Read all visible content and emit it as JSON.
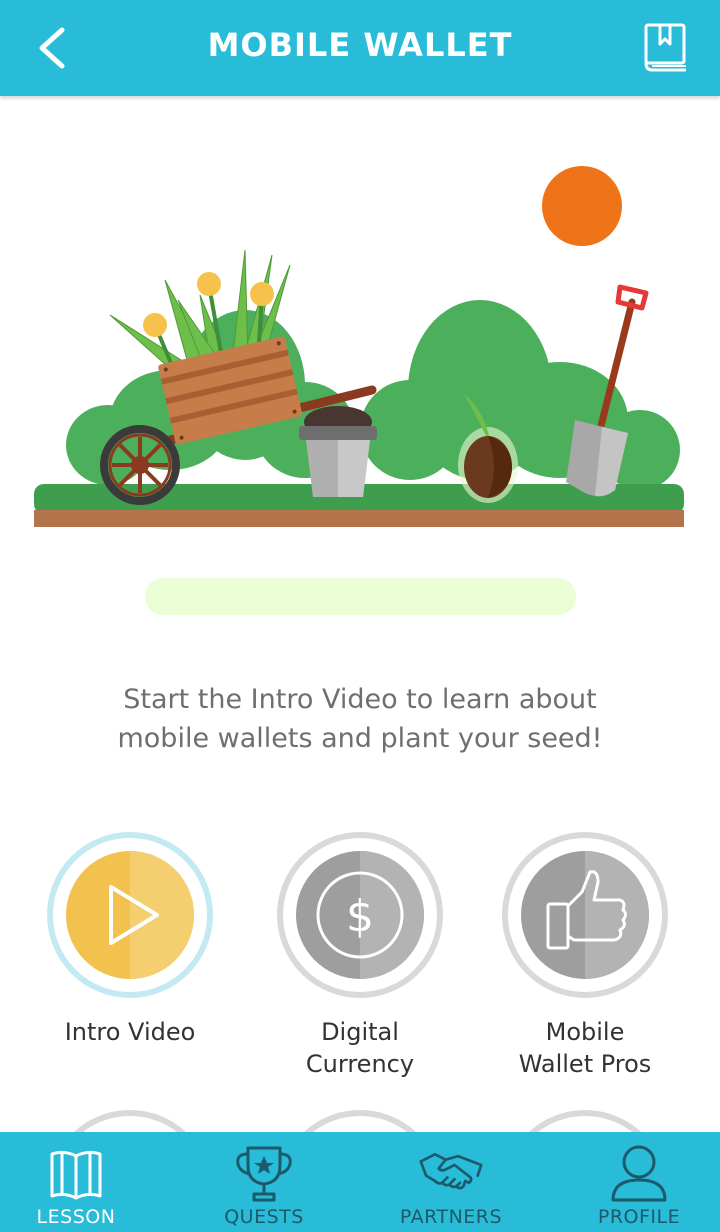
{
  "header": {
    "title": "MOBILE WALLET",
    "back_icon": "chevron-left-icon",
    "book_icon": "book-bookmark-icon",
    "background": "#29BCD9"
  },
  "progress": {
    "fraction": 0
  },
  "intro": {
    "line1": "Start the Intro Video to learn about",
    "line2": "mobile wallets and plant your seed!"
  },
  "lessons": [
    {
      "label": "Intro Video",
      "icon": "play-icon",
      "state": "active"
    },
    {
      "label_line1": "Digital",
      "label_line2": "Currency",
      "icon": "dollar-icon",
      "state": "locked"
    },
    {
      "label_line1": "Mobile",
      "label_line2": "Wallet Pros",
      "icon": "thumbs-up-icon",
      "state": "locked"
    }
  ],
  "tabs": [
    {
      "label": "LESSON",
      "icon": "book-icon",
      "active": true
    },
    {
      "label": "QUESTS",
      "icon": "trophy-icon",
      "active": false
    },
    {
      "label": "PARTNERS",
      "icon": "handshake-icon",
      "active": false
    },
    {
      "label": "PROFILE",
      "icon": "user-icon",
      "active": false
    }
  ],
  "colors": {
    "accent": "#29BCD9",
    "active_lesson": "#F2C14E",
    "locked_lesson": "#9E9E9E",
    "sun": "#EF7318"
  }
}
